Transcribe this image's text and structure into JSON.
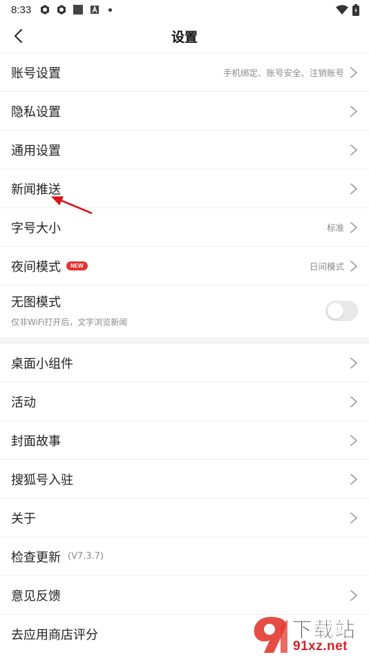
{
  "status_bar": {
    "time": "8:33",
    "left_icons": [
      "app-icon",
      "app-icon",
      "square-icon",
      "a-icon",
      "dot-icon"
    ],
    "right_icons": [
      "wifi-icon",
      "battery-icon"
    ]
  },
  "header": {
    "title": "设置",
    "back_icon": "chevron-left-icon"
  },
  "settings": {
    "account": {
      "label": "账号设置",
      "hint": "手机绑定、账号安全、注销账号"
    },
    "privacy": {
      "label": "隐私设置"
    },
    "general": {
      "label": "通用设置"
    },
    "news_push": {
      "label": "新闻推送"
    },
    "font_size": {
      "label": "字号大小",
      "hint": "标准"
    },
    "night_mode": {
      "label": "夜间模式",
      "badge": "NEW",
      "hint": "日间模式"
    },
    "no_image": {
      "label": "无图模式",
      "subtitle": "仅非WiFi打开后，文字浏览新闻",
      "enabled": false
    },
    "widget": {
      "label": "桌面小组件"
    },
    "activity": {
      "label": "活动"
    },
    "cover_story": {
      "label": "封面故事"
    },
    "sohu_account": {
      "label": "搜狐号入驻"
    },
    "about": {
      "label": "关于"
    },
    "check_update": {
      "label": "检查更新",
      "version": "(V7.3.7)"
    },
    "feedback": {
      "label": "意见反馈"
    },
    "rate_app": {
      "label": "去应用商店评分"
    }
  },
  "colors": {
    "accent_red": "#e5322c",
    "annotation_red": "#d8141b",
    "divider": "#efefef",
    "hint_gray": "#8a8a8a"
  },
  "watermark": {
    "title": "下载站",
    "url": "91xz.net"
  }
}
